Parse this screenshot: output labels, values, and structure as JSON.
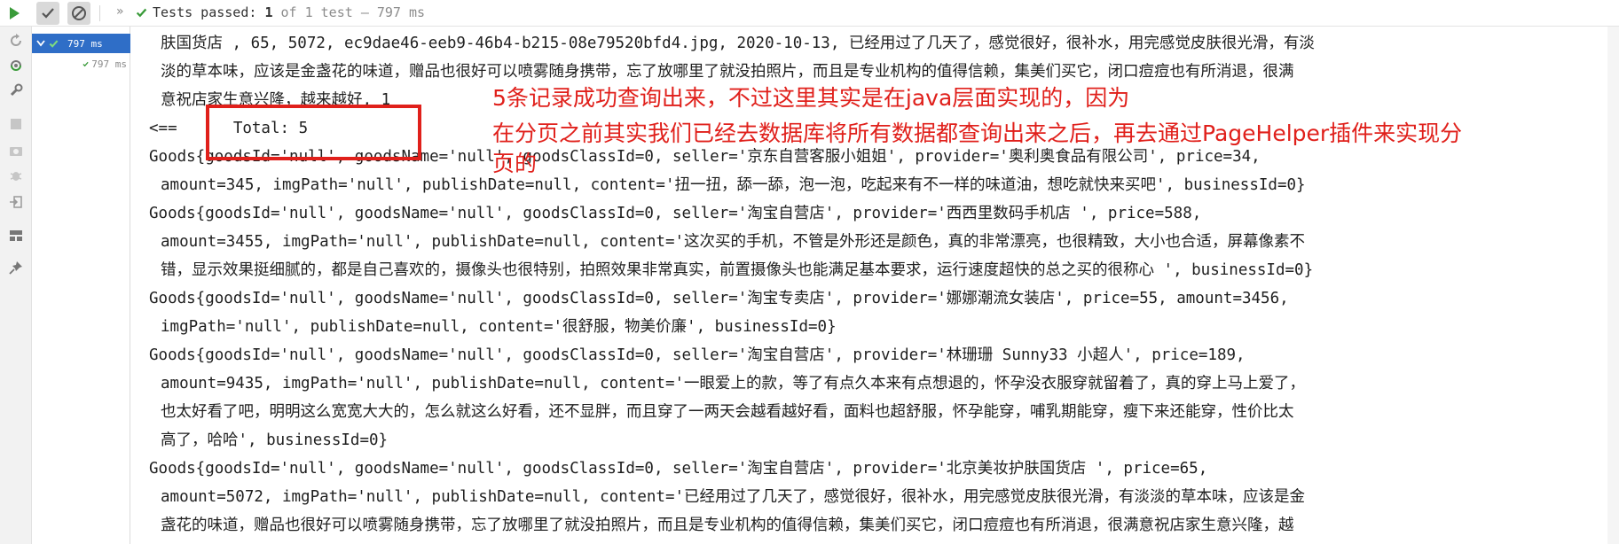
{
  "toolbar": {
    "chevron": "»",
    "status_prefix": "Tests passed:",
    "passed_count": "1",
    "status_suffix": "of 1 test",
    "separator": "–",
    "duration": "797 ms"
  },
  "tree": {
    "root_label": "797 ms",
    "child_label": "797 ms"
  },
  "console": {
    "lines": [
      {
        "text": "肤国货店 , 65, 5072, ec9dae46-eeb9-46b4-b215-08e79520bfd4.jpg, 2020-10-13, 已经用过了几天了，感觉很好，很补水，用完感觉皮肤很光滑，有淡",
        "cont": true
      },
      {
        "text": "淡的草本味，应该是金盏花的味道，赠品也很好可以喷雾随身携带，忘了放哪里了就没拍照片，而且是专业机构的值得信赖，集美们买它，闭口痘痘也有所消退，很满",
        "cont": true
      },
      {
        "text": "意祝店家生意兴隆，越来越好, 1",
        "cont": true
      },
      {
        "text": "<==      Total: 5",
        "cont": false
      },
      {
        "text": "Goods{goodsId='null', goodsName='null', goodsClassId=0, seller='京东自营客服小姐姐', provider='奥利奥食品有限公司', price=34,",
        "cont": false
      },
      {
        "text": "amount=345, imgPath='null', publishDate=null, content='扭一扭，舔一舔，泡一泡，吃起来有不一样的味道油，想吃就快来买吧', businessId=0}",
        "cont": true
      },
      {
        "text": "Goods{goodsId='null', goodsName='null', goodsClassId=0, seller='淘宝自营店', provider='西西里数码手机店 ', price=588,",
        "cont": false
      },
      {
        "text": "amount=3455, imgPath='null', publishDate=null, content='这次买的手机，不管是外形还是颜色，真的非常漂亮，也很精致，大小也合适，屏幕像素不",
        "cont": true
      },
      {
        "text": "错，显示效果挺细腻的，都是自己喜欢的，摄像头也很特别，拍照效果非常真实，前置摄像头也能满足基本要求，运行速度超快的总之买的很称心 ', businessId=0}",
        "cont": true
      },
      {
        "text": "Goods{goodsId='null', goodsName='null', goodsClassId=0, seller='淘宝专卖店', provider='娜娜潮流女装店', price=55, amount=3456,",
        "cont": false
      },
      {
        "text": "imgPath='null', publishDate=null, content='很舒服，物美价廉', businessId=0}",
        "cont": true
      },
      {
        "text": "Goods{goodsId='null', goodsName='null', goodsClassId=0, seller='淘宝自营店', provider='林珊珊 Sunny33 小超人', price=189,",
        "cont": false
      },
      {
        "text": "amount=9435, imgPath='null', publishDate=null, content='一眼爱上的款，等了有点久本来有点想退的，怀孕没衣服穿就留着了，真的穿上马上爱了，",
        "cont": true
      },
      {
        "text": "也太好看了吧，明明这么宽宽大大的，怎么就这么好看，还不显胖，而且穿了一两天会越看越好看，面料也超舒服，怀孕能穿，哺乳期能穿，瘦下来还能穿，性价比太",
        "cont": true
      },
      {
        "text": "高了，哈哈', businessId=0}",
        "cont": true
      },
      {
        "text": "Goods{goodsId='null', goodsName='null', goodsClassId=0, seller='淘宝自营店', provider='北京美妆护肤国货店 ', price=65,",
        "cont": false
      },
      {
        "text": "amount=5072, imgPath='null', publishDate=null, content='已经用过了几天了，感觉很好，很补水，用完感觉皮肤很光滑，有淡淡的草本味，应该是金",
        "cont": true
      },
      {
        "text": "盏花的味道，赠品也很好可以喷雾随身携带，忘了放哪里了就没拍照片，而且是专业机构的值得信赖，集美们买它，闭口痘痘也有所消退，很满意祝店家生意兴隆，越",
        "cont": true
      }
    ]
  },
  "annotation": {
    "line1": "5条记录成功查询出来，不过这里其实是在java层面实现的，因为",
    "line2": "在分页之前其实我们已经去数据库将所有数据都查询出来之后，再去通过PageHelper插件来实现分",
    "line3": "页的",
    "color": "#e0201b"
  },
  "colors": {
    "selected_row": "#2f6ec7",
    "pass_green": "#3a9b3a"
  }
}
